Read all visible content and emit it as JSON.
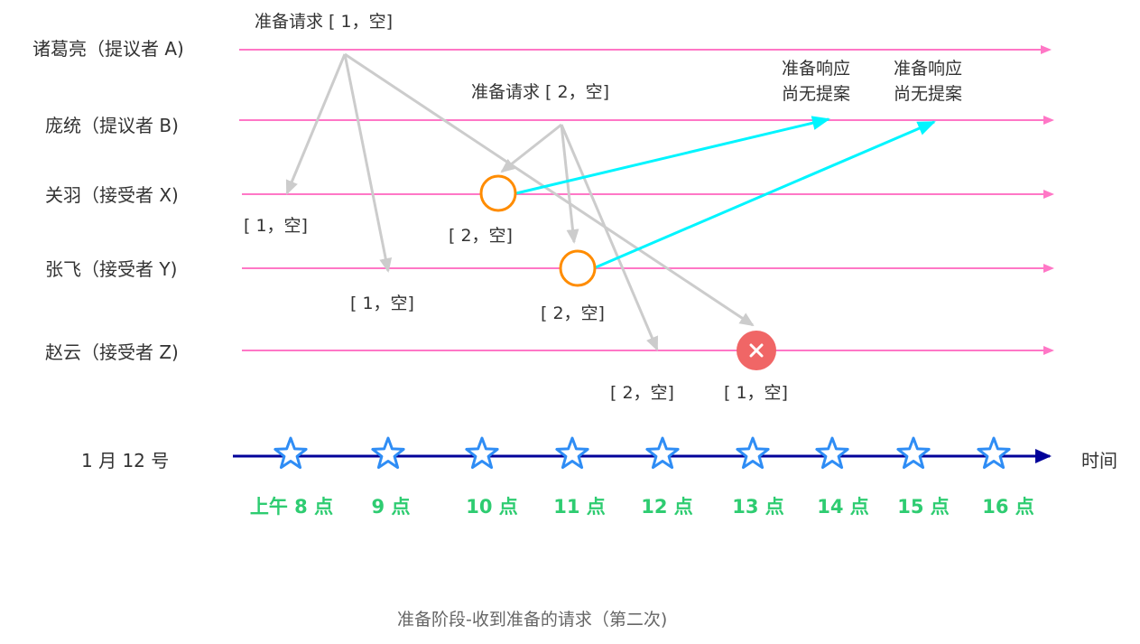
{
  "participants": [
    {
      "id": "A",
      "label": "诸葛亮（提议者 A)"
    },
    {
      "id": "B",
      "label": "庞统（提议者 B)"
    },
    {
      "id": "X",
      "label": "关羽（接受者 X)"
    },
    {
      "id": "Y",
      "label": "张飞（接受者 Y)"
    },
    {
      "id": "Z",
      "label": "赵云（接受者 Z)"
    }
  ],
  "annotations": {
    "req1": "准备请求 [ 1，空]",
    "req2": "准备请求 [ 2，空]",
    "resp1_line1": "准备响应",
    "resp1_line2": "尚无提案",
    "resp2_line1": "准备响应",
    "resp2_line2": "尚无提案",
    "x_val1": "[ 1，空]",
    "x_val2": "[ 2，空]",
    "y_val1": "[ 1，空]",
    "y_val2": "[ 2，空]",
    "z_val2": "[ 2，空]",
    "z_val1": "[ 1，空]"
  },
  "timeline": {
    "date": "1 月 12 号",
    "axis_label": "时间",
    "ticks": [
      "上午 8 点",
      "9 点",
      "10 点",
      "11 点",
      "12 点",
      "13 点",
      "14 点",
      "15 点",
      "16 点"
    ]
  },
  "caption": "准备阶段-收到准备的请求（第二次)",
  "colors": {
    "lifeline": "#ff77c6",
    "request_arrow": "#cccccc",
    "response_arrow": "#00f5ff",
    "accept_circle": "#ff8c00",
    "reject_circle": "#f06666",
    "axis": "#000099",
    "star": "#2f8df5",
    "time_label": "#2ecc71"
  }
}
